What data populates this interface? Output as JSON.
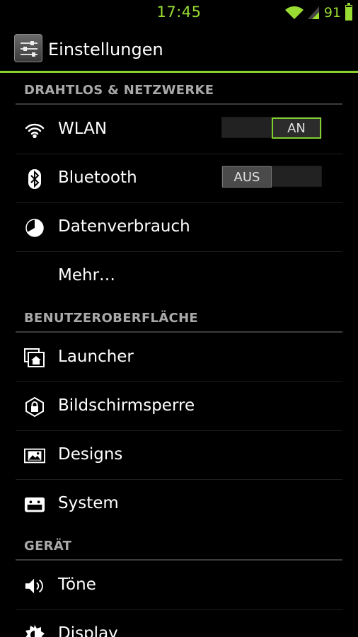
{
  "status_bar": {
    "time": "17:45",
    "battery_percent": "91",
    "battery_level": 0.91
  },
  "action_bar": {
    "title": "Einstellungen",
    "icon": "settings-sliders-icon"
  },
  "sections": {
    "wireless": {
      "header": "DRAHTLOS & NETZWERKE",
      "wlan": {
        "label": "WLAN",
        "icon": "wifi-icon",
        "switch_label": "AN",
        "state": "on"
      },
      "bluetooth": {
        "label": "Bluetooth",
        "icon": "bluetooth-icon",
        "switch_label": "AUS",
        "state": "off"
      },
      "data_usage": {
        "label": "Datenverbrauch",
        "icon": "pie-chart-icon"
      },
      "more": {
        "label": "Mehr…"
      }
    },
    "ui": {
      "header": "BENUTZEROBERFLÄCHE",
      "launcher": {
        "label": "Launcher",
        "icon": "home-icon"
      },
      "lockscreen": {
        "label": "Bildschirmsperre",
        "icon": "lock-icon"
      },
      "designs": {
        "label": "Designs",
        "icon": "image-icon"
      },
      "system": {
        "label": "System",
        "icon": "android-icon"
      }
    },
    "device": {
      "header": "GERÄT",
      "sounds": {
        "label": "Töne",
        "icon": "speaker-icon"
      },
      "display": {
        "label": "Display",
        "icon": "brightness-icon"
      }
    }
  },
  "colors": {
    "accent": "#8bd230",
    "status_green": "#99dd33",
    "header_text": "#a9a9a9",
    "divider": "#3c3c3c"
  }
}
